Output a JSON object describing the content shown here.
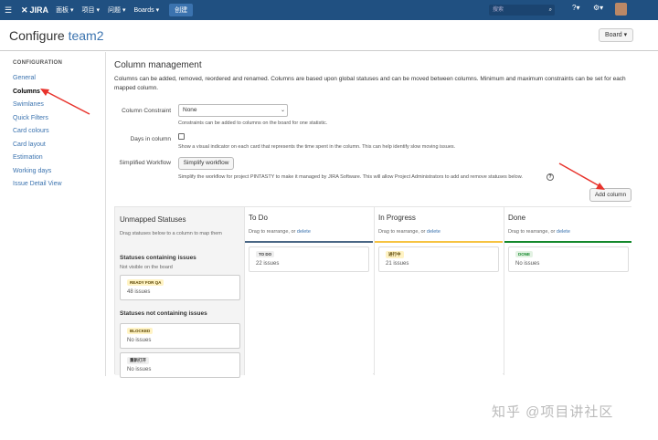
{
  "topbar": {
    "logo": "JIRA",
    "nav": [
      "面板 ▾",
      "项目 ▾",
      "问题 ▾",
      "Boards ▾"
    ],
    "create_label": "创建",
    "search_placeholder": "搜索"
  },
  "header": {
    "title_prefix": "Configure ",
    "project": "team2",
    "board_button": "Board ▾"
  },
  "sidebar": {
    "section_title": "CONFIGURATION",
    "items": [
      "General",
      "Columns",
      "Swimlanes",
      "Quick Filters",
      "Card colours",
      "Card layout",
      "Estimation",
      "Working days",
      "Issue Detail View"
    ]
  },
  "main": {
    "heading": "Column management",
    "description": "Columns can be added, removed, reordered and renamed. Columns are based upon global statuses and can be moved between columns. Minimum and maximum constraints can be set for each mapped column.",
    "constraint_label": "Column Constraint",
    "constraint_value": "None",
    "constraint_help": "Constraints can be added to columns on the board for one statistic.",
    "days_label": "Days in column",
    "days_help": "Show a visual indicator on each card that represents the time spent in the column. This can help identify slow moving issues.",
    "simplified_label": "Simplified Workflow",
    "simplify_button": "Simplify workflow",
    "simplified_help": "Simplify the workflow for project PINTASTY to make it managed by JIRA Software. This will allow Project Administrators to add and remove statuses below.",
    "add_column_button": "Add column"
  },
  "unmapped": {
    "title": "Unmapped Statuses",
    "sub": "Drag statuses below to a column to map them",
    "group1_title": "Statuses containing issues",
    "group1_sub": "Not visible on the board",
    "group1_cards": [
      {
        "status": "READY FOR QA",
        "count": "48 issues"
      }
    ],
    "group2_title": "Statuses not containing issues",
    "group2_cards": [
      {
        "status": "BLOCKED",
        "count": "No issues"
      },
      {
        "status": "重新打开",
        "count": "No issues"
      }
    ]
  },
  "columns": [
    {
      "title": "To Do",
      "sub": "Drag to rearrange, or ",
      "delete": "delete",
      "status": "TO DO",
      "count": "22 issues",
      "color": "#4a6785",
      "loz_bg": "#eee",
      "loz_fg": "#333"
    },
    {
      "title": "In Progress",
      "sub": "Drag to rearrange, or ",
      "delete": "delete",
      "status": "进行中",
      "count": "21 issues",
      "color": "#f6c342",
      "loz_bg": "#fff3c4",
      "loz_fg": "#594300"
    },
    {
      "title": "Done",
      "sub": "Drag to rearrange, or ",
      "delete": "delete",
      "status": "DONE",
      "count": "No issues",
      "color": "#14892c",
      "loz_bg": "#e3f2e3",
      "loz_fg": "#14892c"
    }
  ],
  "watermark": "知乎 @项目讲社区",
  "colors": {
    "topbar": "#205081",
    "link": "#3b73af",
    "annotation_arrow": "#e8332c"
  }
}
